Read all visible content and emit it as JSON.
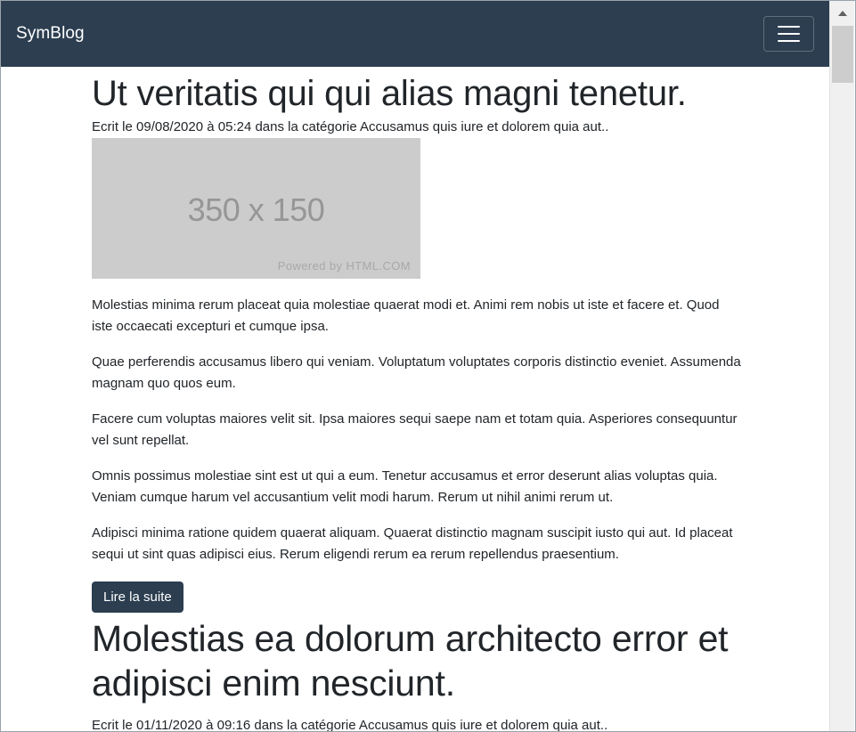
{
  "navbar": {
    "brand": "SymBlog",
    "toggler_icon": "hamburger-icon"
  },
  "posts": [
    {
      "title": "Ut veritatis qui qui alias magni tenetur.",
      "meta": "Ecrit le 09/08/2020 à 05:24 dans la catégorie Accusamus quis iure et dolorem quia aut..",
      "image": {
        "size_text": "350 x 150",
        "powered_text": "Powered by HTML.COM"
      },
      "paragraphs": [
        "Molestias minima rerum placeat quia molestiae quaerat modi et. Animi rem nobis ut iste et facere et. Quod iste occaecati excepturi et cumque ipsa.",
        "Quae perferendis accusamus libero qui veniam. Voluptatum voluptates corporis distinctio eveniet. Assumenda magnam quo quos eum.",
        "Facere cum voluptas maiores velit sit. Ipsa maiores sequi saepe nam et totam quia. Asperiores consequuntur vel sunt repellat.",
        "Omnis possimus molestiae sint est ut qui a eum. Tenetur accusamus et error deserunt alias voluptas quia. Veniam cumque harum vel accusantium velit modi harum. Rerum ut nihil animi rerum ut.",
        "Adipisci minima ratione quidem quaerat aliquam. Quaerat distinctio magnam suscipit iusto qui aut. Id placeat sequi ut sint quas adipisci eius. Rerum eligendi rerum ea rerum repellendus praesentium."
      ],
      "read_more": "Lire la suite"
    },
    {
      "title": "Molestias ea dolorum architecto error et adipisci enim nesciunt.",
      "meta": "Ecrit le 01/11/2020 à 09:16 dans la catégorie Accusamus quis iure et dolorem quia aut.."
    }
  ],
  "scrollbar": {
    "up_icon": "scroll-up-arrow-icon"
  },
  "colors": {
    "navbar": "#2c3e50",
    "button": "#2c3e50",
    "placeholder": "#cccccc"
  }
}
